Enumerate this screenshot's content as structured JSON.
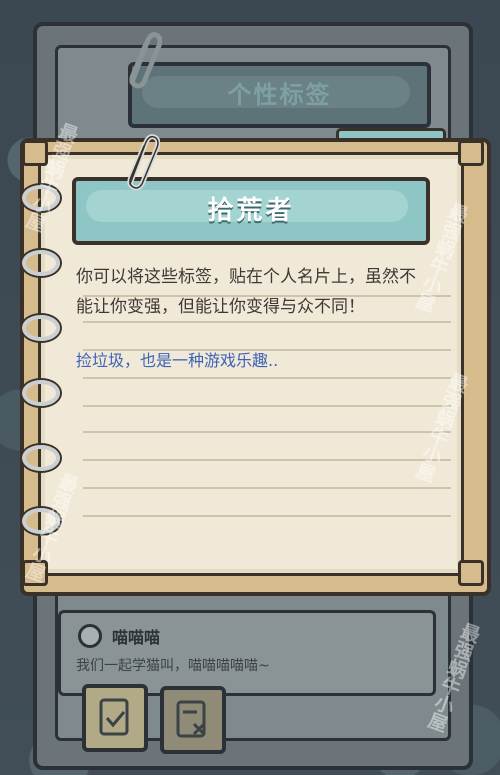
{
  "background_panel": {
    "title": "个性标签"
  },
  "tab": {
    "label": "个性标签"
  },
  "card": {
    "title": "拾荒者",
    "description": "你可以将这些标签，贴在个人名片上，虽然不能让你变强，但能让你变得与众不同！",
    "flavor": "捡垃圾，也是一种游戏乐趣.."
  },
  "bottom_card": {
    "name": "喵喵喵",
    "description": "我们一起学猫叫，喵喵喵喵喵~"
  },
  "watermarks": [
    "最强蜗牛小屋",
    "最强蜗牛小屋",
    "最强蜗牛小屋",
    "最强蜗牛小屋",
    "最强蜗牛小屋"
  ],
  "colors": {
    "banner": "#8ec5c5",
    "page": "#f1e9d8",
    "flavor_text": "#3d62b8",
    "frame": "#d6bb8c"
  },
  "icons": [
    "paperclip-icon",
    "binder-ring-icon",
    "checklist-icon",
    "remove-list-icon"
  ]
}
